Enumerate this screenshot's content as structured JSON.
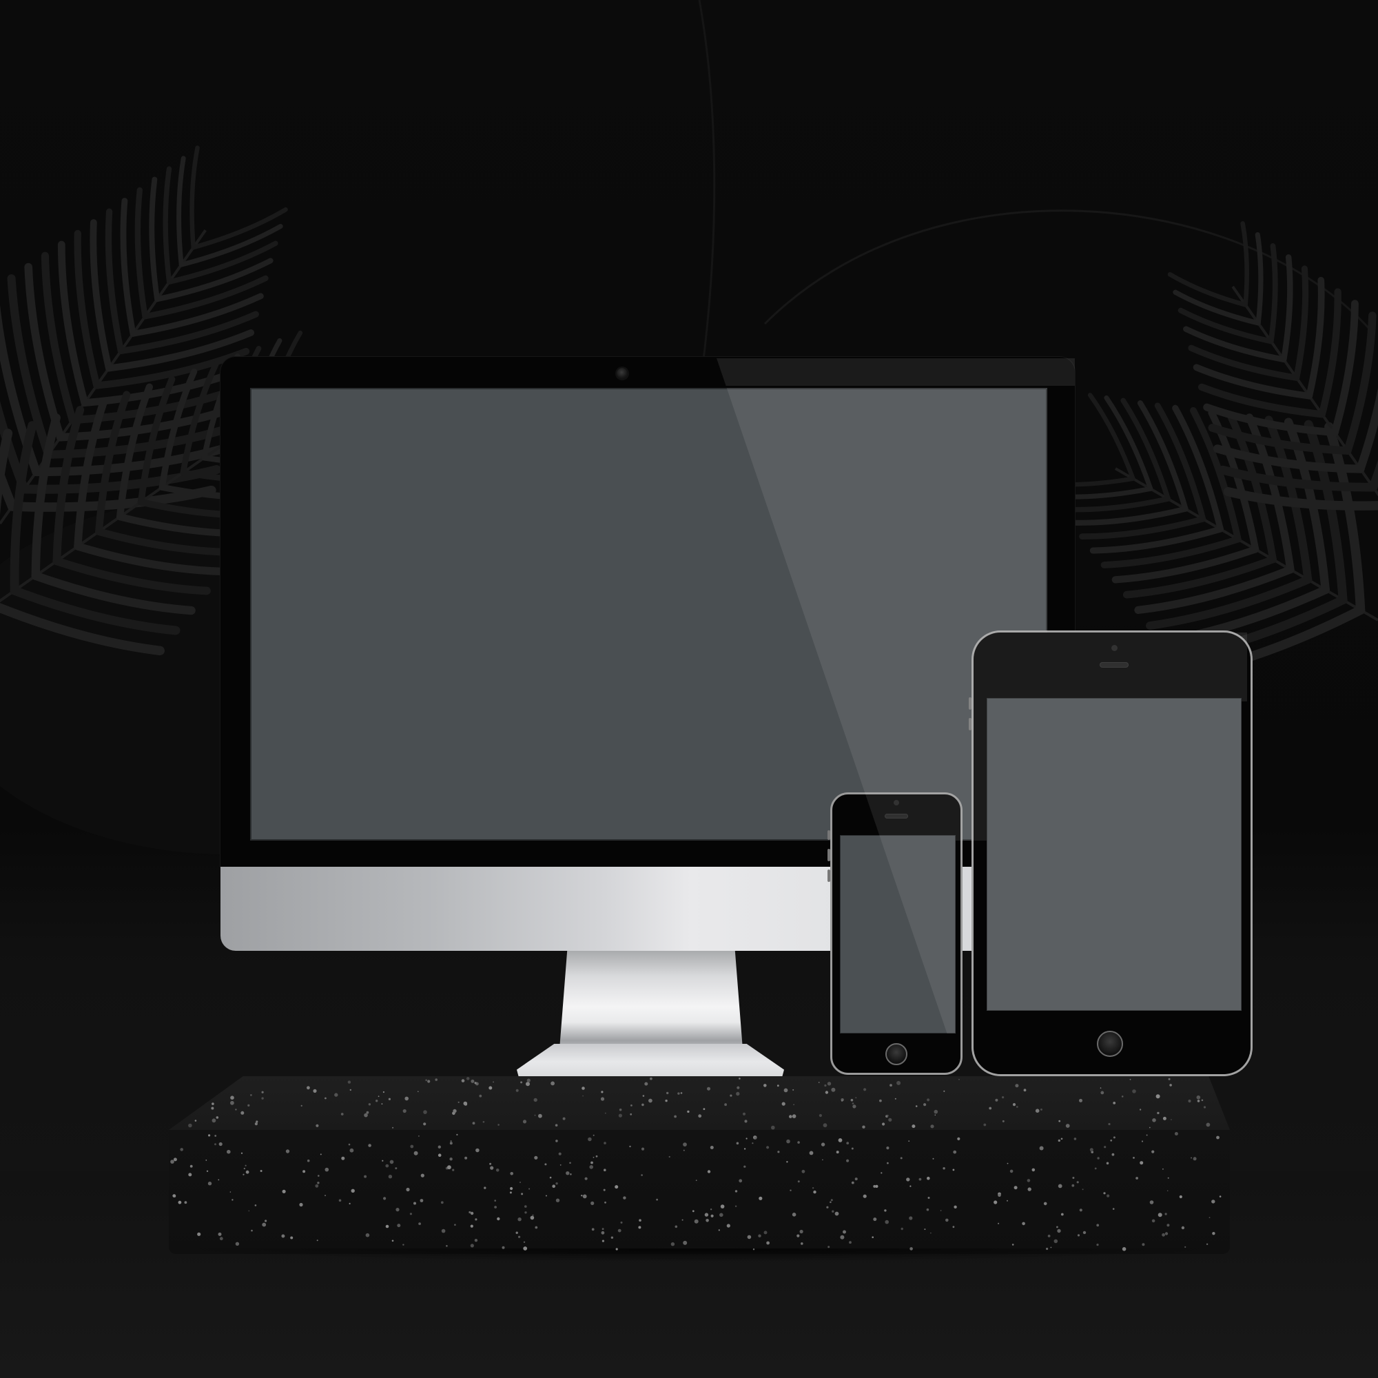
{
  "scene": {
    "subject": "device-mockup",
    "devices": [
      "desktop-monitor",
      "smartphone",
      "tablet"
    ],
    "palette": {
      "background": "#0a0a0a",
      "screen": "#4a4f52",
      "bezel": "#050505",
      "aluminum_light": "#e9e9eb",
      "aluminum_dark": "#9ea0a3",
      "stone": "#121212",
      "speckle": "#6b6b6b"
    }
  }
}
